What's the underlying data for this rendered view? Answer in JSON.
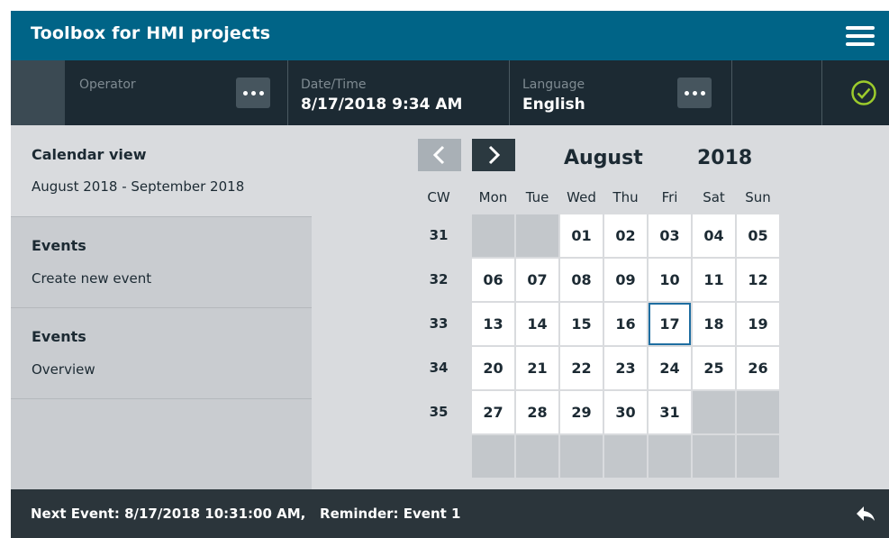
{
  "header": {
    "title": "Toolbox for HMI projects",
    "menu_icon": "hamburger-menu-icon"
  },
  "status": {
    "operator_label": "Operator",
    "datetime_label": "Date/Time",
    "datetime_value": "8/17/2018 9:34 AM",
    "language_label": "Language",
    "language_value": "English",
    "ok_icon": "check-circle-icon",
    "ok_color": "#9ccb2c"
  },
  "sidebar": {
    "calendar_title": "Calendar view",
    "calendar_range": "August 2018 - September 2018",
    "items": [
      {
        "title": "Events",
        "subtitle": "Create new event"
      },
      {
        "title": "Events",
        "subtitle": "Overview"
      }
    ]
  },
  "calendar": {
    "month": "August",
    "year": "2018",
    "cw_header": "CW",
    "weekdays": [
      "Mon",
      "Tue",
      "Wed",
      "Thu",
      "Fri",
      "Sat",
      "Sun"
    ],
    "weeks": [
      {
        "cw": "31",
        "days": [
          "",
          "",
          "01",
          "02",
          "03",
          "04",
          "05"
        ]
      },
      {
        "cw": "32",
        "days": [
          "06",
          "07",
          "08",
          "09",
          "10",
          "11",
          "12"
        ]
      },
      {
        "cw": "33",
        "days": [
          "13",
          "14",
          "15",
          "16",
          "17",
          "18",
          "19"
        ]
      },
      {
        "cw": "34",
        "days": [
          "20",
          "21",
          "22",
          "23",
          "24",
          "25",
          "26"
        ]
      },
      {
        "cw": "35",
        "days": [
          "27",
          "28",
          "29",
          "30",
          "31",
          "",
          ""
        ]
      },
      {
        "cw": "",
        "days": [
          "",
          "",
          "",
          "",
          "",
          "",
          ""
        ]
      }
    ],
    "selected_day": "17",
    "accent": "#1f6ea1"
  },
  "footer": {
    "text": "Next Event: 8/17/2018 10:31:00 AM,   Reminder: Event 1",
    "back_icon": "reply-icon"
  }
}
